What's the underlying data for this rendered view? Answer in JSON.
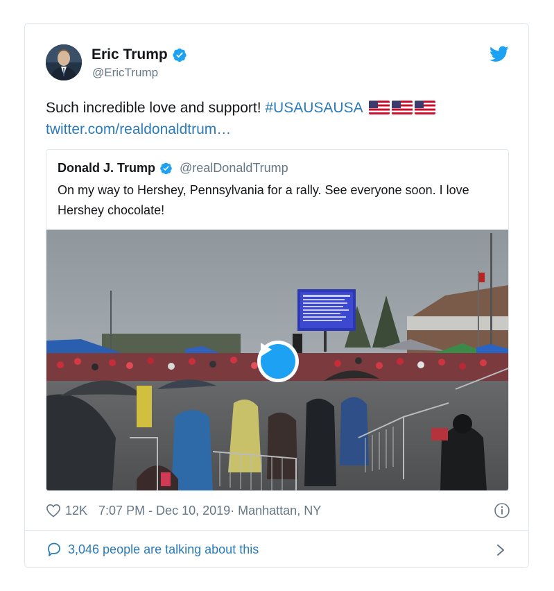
{
  "author": {
    "name": "Eric Trump",
    "handle": "@EricTrump"
  },
  "tweet": {
    "text_prefix": "Such incredible love and support! ",
    "hashtag": "#USAUSAUSA",
    "link": "twitter.com/realdonaldtrum…"
  },
  "quoted": {
    "name": "Donald J. Trump",
    "handle": "@realDonaldTrump",
    "text": "On my way to Hershey, Pennsylvania for a rally. See everyone soon. I love Hershey chocolate!"
  },
  "footer": {
    "likes": "12K",
    "time": "7:07 PM - Dec 10, 2019",
    "location": " · Manhattan, NY",
    "talking": "3,046 people are talking about this"
  },
  "colors": {
    "link": "#2b7bb9",
    "brand": "#1da1f2",
    "muted": "#657786",
    "border": "#e1e8ed"
  },
  "icons": [
    "verified-icon",
    "twitter-bird-icon",
    "us-flag-icon",
    "play-icon",
    "heart-icon",
    "info-icon",
    "comment-icon",
    "chevron-right-icon"
  ]
}
